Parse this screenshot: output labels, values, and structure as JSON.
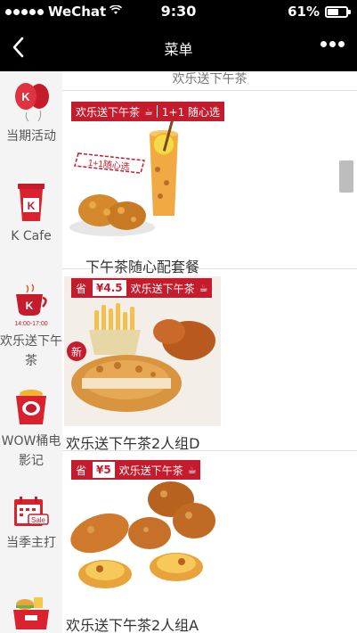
{
  "status_bar": {
    "carrier": "WeChat",
    "time": "9:30",
    "battery": "61%"
  },
  "nav": {
    "title": "菜单",
    "back_icon": "chevron-left-icon",
    "more_icon": "more-dots-icon"
  },
  "sidebar": {
    "items": [
      {
        "label": "当期活动",
        "icon": "balloon-icon"
      },
      {
        "label": "K Cafe",
        "icon": "coffee-cup-icon"
      },
      {
        "label": "欢乐送下午茶",
        "icon": "teacup-icon",
        "icon_text": "14:00-17:00"
      },
      {
        "label": "WOW桶电影记",
        "icon": "bucket-icon"
      },
      {
        "label": "当季主打",
        "icon": "calendar-sale-icon",
        "icon_text": "Sale"
      },
      {
        "label": "",
        "icon": "burger-box-icon"
      }
    ]
  },
  "main": {
    "section_title": "欢乐送下午茶",
    "products": [
      {
        "name": "下午茶随心配套餐",
        "tag": "欢乐送下午茶",
        "tag_extra": "1+1 随心选",
        "overlay_text": "1+1随心选",
        "badge": ""
      },
      {
        "name": "欢乐送下午茶2人组D",
        "tag": "欢乐送下午茶",
        "price_prefix": "省",
        "price": "¥4.5",
        "badge": "新"
      },
      {
        "name": "欢乐送下午茶2人组A",
        "tag": "欢乐送下午茶",
        "price_prefix": "省",
        "price": "¥5",
        "badge": ""
      }
    ]
  },
  "colors": {
    "brand_red": "#c51c2d",
    "sidebar_bg": "#f4f4f4",
    "bar_bg": "#000000"
  }
}
